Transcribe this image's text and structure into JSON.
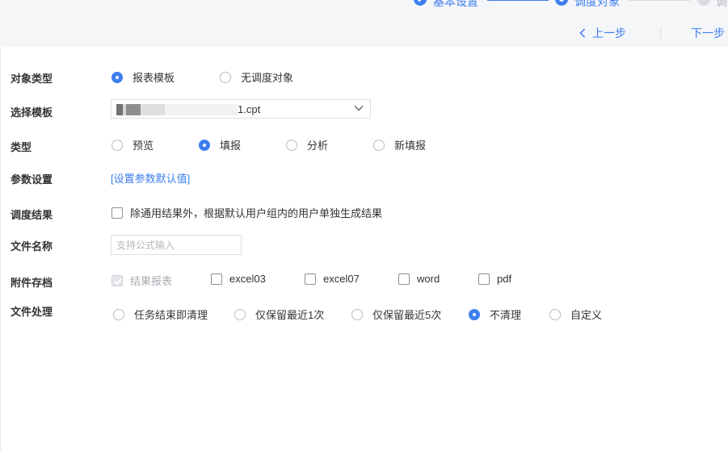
{
  "colors": {
    "accent": "#3d7eef",
    "step_inactive": "#d9dbe0",
    "topbar_bg": "#f5f6f8"
  },
  "steps": [
    {
      "label": "基本设置",
      "state": "done",
      "icon": "check-icon"
    },
    {
      "label": "调度对象",
      "state": "current",
      "icon": "current-step-icon"
    },
    {
      "label": "调",
      "state": "pending",
      "icon": "pending-step-icon"
    }
  ],
  "nav": {
    "prev_label": "上一步",
    "next_label": "下一步"
  },
  "form": {
    "object_type": {
      "label": "对象类型",
      "options": [
        "报表模板",
        "无调度对象"
      ],
      "selected": "报表模板"
    },
    "template": {
      "label": "选择模板",
      "value_visible_part": "1.cpt"
    },
    "type": {
      "label": "类型",
      "options": [
        "预览",
        "填报",
        "分析",
        "新填报"
      ],
      "selected": "填报"
    },
    "params": {
      "label": "参数设置",
      "link_text": "[设置参数默认值]"
    },
    "result": {
      "label": "调度结果",
      "checkbox_text": "除通用结果外，根据默认用户组内的用户单独生成结果",
      "checked": false
    },
    "file_name": {
      "label": "文件名称",
      "placeholder": "支持公式输入",
      "value": ""
    },
    "attachments": {
      "label": "附件存档",
      "options": [
        {
          "text": "结果报表",
          "checked": true,
          "disabled": true
        },
        {
          "text": "excel03",
          "checked": false,
          "disabled": false
        },
        {
          "text": "excel07",
          "checked": false,
          "disabled": false
        },
        {
          "text": "word",
          "checked": false,
          "disabled": false
        },
        {
          "text": "pdf",
          "checked": false,
          "disabled": false
        }
      ]
    },
    "file_handling": {
      "label": "文件处理",
      "options": [
        "任务结束即清理",
        "仅保留最近1次",
        "仅保留最近5次",
        "不清理",
        "自定义"
      ],
      "selected": "不清理"
    }
  }
}
